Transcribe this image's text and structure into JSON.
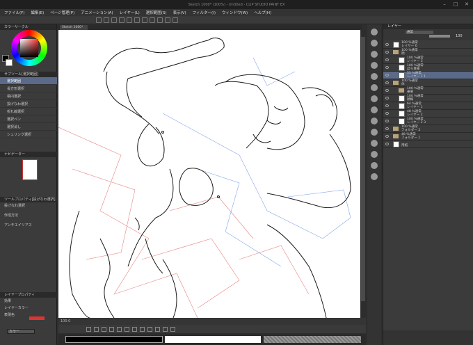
{
  "window": {
    "title": "Sketch 1000* (100%) - Untitled - CLIP STUDIO PAINT EX"
  },
  "menu": [
    "ファイル(F)",
    "編集(E)",
    "ページ管理(P)",
    "アニメーション(A)",
    "レイヤー(L)",
    "選択範囲(S)",
    "表示(V)",
    "フィルター(I)",
    "ウィンドウ(W)",
    "ヘルプ(H)"
  ],
  "colors": {
    "accent": "#5a6a88",
    "canvas": "#ffffff",
    "panel": "#3b3b3b",
    "lineart": "#1a1a1a",
    "sketch_red": "#e05050",
    "sketch_blue": "#5080e0"
  },
  "left": {
    "color_title": "カラーサークル",
    "subtool_title": "サブツール[選択範囲]",
    "subtools": [
      "選択範囲",
      "長方形選択",
      "楕円選択",
      "投げなわ選択",
      "折れ線選択",
      "選択ペン",
      "選択消し",
      "シュリンク選択"
    ],
    "navigator_title": "ナビゲーター",
    "toolprop_title": "ツールプロパティ[投げなわ選択]",
    "toolprop_sub": "投げなわ選択",
    "toolprop_rows": [
      "作成方法",
      "アンチエイリアス"
    ],
    "layerprop_title": "レイヤープロパティ",
    "layerprop_rows": [
      "効果",
      "レイヤーカラー",
      "表現色"
    ],
    "expression_value": "カラー"
  },
  "canvas": {
    "tab": "Sketch 1000*",
    "status_zoom": "100.0"
  },
  "right": {
    "title": "レイヤー",
    "blend": "通常",
    "opacity": "100",
    "layers": [
      {
        "pct": "100 %通常",
        "name": "レイヤー 6",
        "indent": 0,
        "folder": false
      },
      {
        "pct": "100 %通常",
        "name": "顔",
        "indent": 0,
        "folder": true
      },
      {
        "pct": "100 %通常",
        "name": "レイヤー 3",
        "indent": 1,
        "folder": false
      },
      {
        "pct": "100 %通常",
        "name": "ぽろ目線",
        "indent": 1,
        "folder": false
      },
      {
        "pct": "55 %通常",
        "name": "レイヤー 1 1",
        "indent": 1,
        "folder": false,
        "selected": true
      },
      {
        "pct": "100 %通常",
        "name": "体",
        "indent": 0,
        "folder": true
      },
      {
        "pct": "100 %通常",
        "name": "乗車",
        "indent": 1,
        "folder": true
      },
      {
        "pct": "100 %通常",
        "name": "顔線",
        "indent": 1,
        "folder": false
      },
      {
        "pct": "64 %通常",
        "name": "レイヤー 1",
        "indent": 1,
        "folder": false
      },
      {
        "pct": "48 %通常",
        "name": "レイヤー 2",
        "indent": 1,
        "folder": false
      },
      {
        "pct": "100 %通常",
        "name": "レイヤー 2 3",
        "indent": 1,
        "folder": false
      },
      {
        "pct": "100 %通常",
        "name": "フォルダー 2",
        "indent": 0,
        "folder": true
      },
      {
        "pct": "48 %通常",
        "name": "フォルダー 1",
        "indent": 0,
        "folder": true
      },
      {
        "pct": "",
        "name": "用紙",
        "indent": 0,
        "folder": false
      }
    ]
  }
}
